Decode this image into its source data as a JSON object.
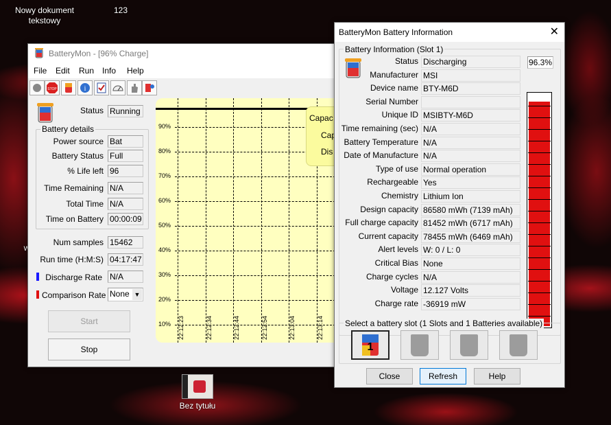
{
  "desktop": {
    "icons": [
      {
        "label": "Nowy dokument tekstowy"
      },
      {
        "label": "123"
      },
      {
        "label": "Bez tytułu"
      }
    ],
    "stray_text": "w"
  },
  "main_window": {
    "title": "BatteryMon - [96% Charge]",
    "menu": [
      "File",
      "Edit",
      "Run",
      "Info",
      "Help"
    ],
    "toolbar": [
      "record-icon",
      "stop-icon",
      "battery-icon",
      "battery-info-icon",
      "checklist-icon",
      "gauge-icon",
      "hand-icon",
      "settings-icon"
    ],
    "status_label": "Status",
    "status_value": "Running",
    "battery_details_title": "Battery details",
    "details": [
      {
        "label": "Power source",
        "value": "Bat"
      },
      {
        "label": "Battery Status",
        "value": "Full"
      },
      {
        "label": "% Life left",
        "value": "96"
      },
      {
        "label": "Time Remaining",
        "value": "N/A"
      },
      {
        "label": "Total Time",
        "value": "N/A"
      },
      {
        "label": "Time on Battery",
        "value": "00:00:09"
      }
    ],
    "num_samples_label": "Num samples",
    "num_samples_value": "15462",
    "run_time_label": "Run time (H:M:S)",
    "run_time_value": "04:17:47",
    "discharge_rate_label": "Discharge Rate",
    "discharge_rate_value": "N/A",
    "discharge_color": "#1a1aff",
    "comparison_rate_label": "Comparison Rate",
    "comparison_rate_value": "None",
    "comparison_color": "#e01010",
    "start_label": "Start",
    "stop_label": "Stop",
    "graph": {
      "y_ticks": [
        "90%",
        "80%",
        "70%",
        "60%",
        "50%",
        "40%",
        "30%",
        "20%",
        "10%"
      ],
      "x_ticks": [
        "22:12:23",
        "22:12:34",
        "22:12:44",
        "22:12:54",
        "22:13:04",
        "22:13:14"
      ],
      "legend": [
        "Capac",
        "Cap",
        "Dis"
      ]
    }
  },
  "info_window": {
    "title": "BatteryMon Battery Information",
    "group_title": "Battery Information (Slot 1)",
    "rows": [
      {
        "label": "Status",
        "value": "Discharging"
      },
      {
        "label": "Manufacturer",
        "value": "MSI"
      },
      {
        "label": "Device name",
        "value": "BTY-M6D"
      },
      {
        "label": "Serial Number",
        "value": ""
      },
      {
        "label": "Unique ID",
        "value": "MSIBTY-M6D"
      },
      {
        "label": "Time remaining (sec)",
        "value": "N/A"
      },
      {
        "label": "Battery Temperature",
        "value": "N/A"
      },
      {
        "label": "Date of Manufacture",
        "value": "N/A"
      },
      {
        "label": "Type of use",
        "value": "Normal operation"
      },
      {
        "label": "Rechargeable",
        "value": "Yes"
      },
      {
        "label": "Chemistry",
        "value": "Lithium Ion"
      },
      {
        "label": "Design capacity",
        "value": "86580 mWh (7139 mAh)"
      },
      {
        "label": "Full charge capacity",
        "value": "81452 mWh (6717 mAh)"
      },
      {
        "label": "Current capacity",
        "value": "78455 mWh (6469 mAh)"
      },
      {
        "label": "Alert levels",
        "value": "W: 0 / L: 0"
      },
      {
        "label": "Critical Bias",
        "value": "None"
      },
      {
        "label": "Charge cycles",
        "value": "N/A"
      },
      {
        "label": "Voltage",
        "value": "12.127 Volts"
      },
      {
        "label": "Charge rate",
        "value": "-36919 mW"
      }
    ],
    "charge_percent_text": "96.3%",
    "charge_fraction": 0.963,
    "gauge_color": "#e01010",
    "slot_group_title": "Select a battery slot (1 Slots and 1 Batteries available)",
    "slots": [
      {
        "number": "1",
        "active": true
      },
      {
        "number": "",
        "active": false
      },
      {
        "number": "",
        "active": false
      },
      {
        "number": "",
        "active": false
      }
    ],
    "close_label": "Close",
    "refresh_label": "Refresh",
    "help_label": "Help"
  }
}
